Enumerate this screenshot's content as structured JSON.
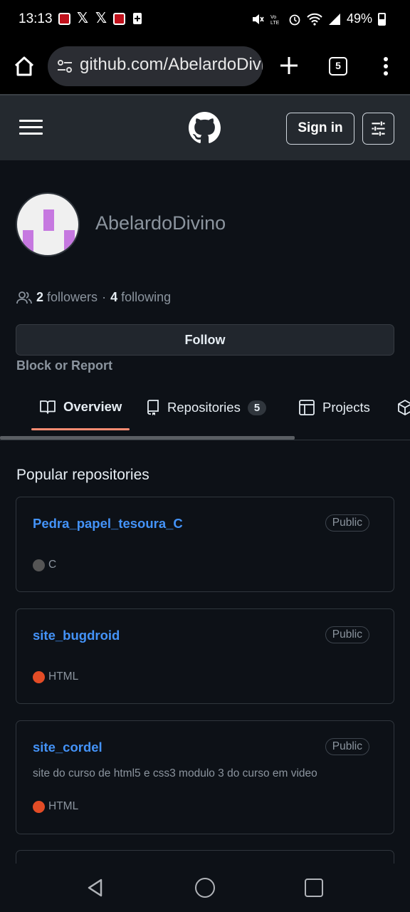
{
  "status_bar": {
    "time": "13:13",
    "battery": "49%",
    "network_label": "Vo LTE"
  },
  "browser": {
    "url": "github.com/AbelardoDivino",
    "tab_count": "5"
  },
  "header": {
    "sign_in_label": "Sign in"
  },
  "profile": {
    "username": "AbelardoDivino",
    "followers_count": "2",
    "followers_label": "followers",
    "separator": "·",
    "following_count": "4",
    "following_label": "following",
    "follow_label": "Follow",
    "block_label": "Block or Report"
  },
  "tabs": [
    {
      "label": "Overview",
      "icon": "book-icon",
      "active": true
    },
    {
      "label": "Repositories",
      "icon": "repo-icon",
      "counter": "5"
    },
    {
      "label": "Projects",
      "icon": "table-icon"
    },
    {
      "label": "",
      "icon": "package-icon"
    }
  ],
  "popular": {
    "title": "Popular repositories",
    "repos": [
      {
        "name": "Pedra_papel_tesoura_C",
        "visibility": "Public",
        "description": "",
        "language": "C",
        "language_color": "#555555"
      },
      {
        "name": "site_bugdroid",
        "visibility": "Public",
        "description": "",
        "language": "HTML",
        "language_color": "#e34c26"
      },
      {
        "name": "site_cordel",
        "visibility": "Public",
        "description": "site do curso de html5 e css3 modulo 3 do curso em video",
        "language": "HTML",
        "language_color": "#e34c26"
      }
    ]
  },
  "colors": {
    "accent_link": "#4493f8",
    "tab_underline": "#fd8c73",
    "background": "#0d1117"
  }
}
